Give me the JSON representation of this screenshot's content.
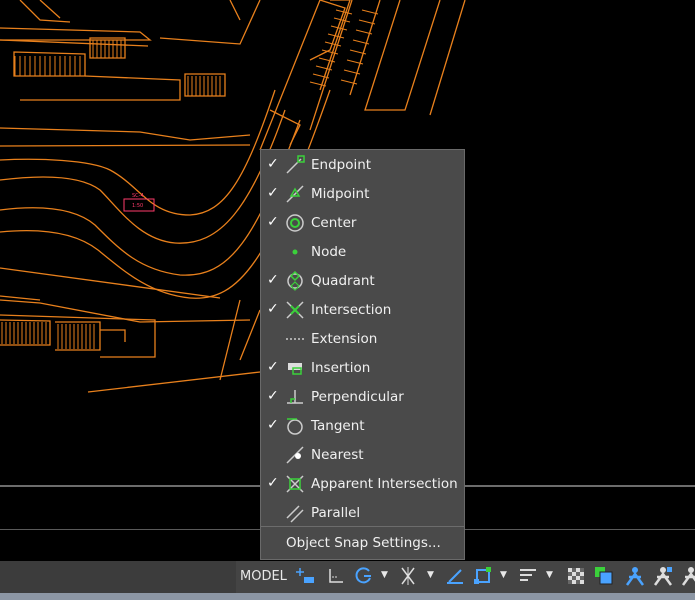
{
  "snap_menu": {
    "items": [
      {
        "label": "Endpoint",
        "checked": true,
        "icon": "endpoint-snap-icon"
      },
      {
        "label": "Midpoint",
        "checked": true,
        "icon": "midpoint-snap-icon"
      },
      {
        "label": "Center",
        "checked": true,
        "icon": "center-snap-icon"
      },
      {
        "label": "Node",
        "checked": false,
        "icon": "node-snap-icon"
      },
      {
        "label": "Quadrant",
        "checked": true,
        "icon": "quadrant-snap-icon"
      },
      {
        "label": "Intersection",
        "checked": true,
        "icon": "intersection-snap-icon"
      },
      {
        "label": "Extension",
        "checked": false,
        "icon": "extension-snap-icon"
      },
      {
        "label": "Insertion",
        "checked": true,
        "icon": "insertion-snap-icon"
      },
      {
        "label": "Perpendicular",
        "checked": true,
        "icon": "perpendicular-snap-icon"
      },
      {
        "label": "Tangent",
        "checked": true,
        "icon": "tangent-snap-icon"
      },
      {
        "label": "Nearest",
        "checked": false,
        "icon": "nearest-snap-icon"
      },
      {
        "label": "Apparent Intersection",
        "checked": true,
        "icon": "apparent-intersection-snap-icon"
      },
      {
        "label": "Parallel",
        "checked": false,
        "icon": "parallel-snap-icon"
      }
    ],
    "checkmark": "✓",
    "settings_label": "Object Snap Settings..."
  },
  "status_bar": {
    "model_label": "MODEL",
    "dropdown_glyph": "▼",
    "icons": [
      "grid-snap-icon",
      "ortho-icon",
      "polar-tracking-icon",
      "osnap-tracking-icon",
      "dynamic-ucs-icon",
      "object-snap-icon",
      "lineweight-icon",
      "transparency-icon",
      "selection-cycling-icon",
      "annotation-scale-icon",
      "annotation-visibility-icon",
      "auto-scale-icon"
    ]
  },
  "drawing": {
    "label_line1": "SC-4",
    "label_line2": "1:50"
  }
}
